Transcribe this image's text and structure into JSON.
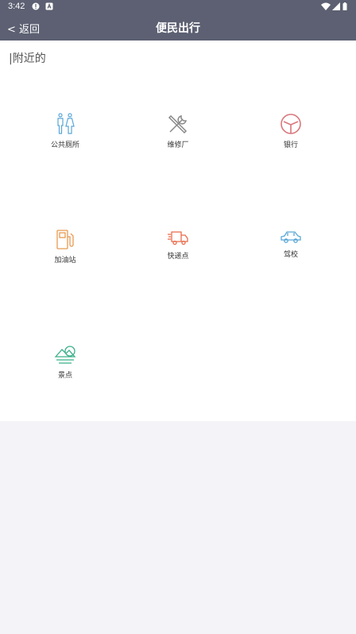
{
  "status_bar": {
    "time": "3:42"
  },
  "nav": {
    "back_label": "< 返回",
    "title": "便民出行"
  },
  "section": {
    "title": "|附近的"
  },
  "grid": [
    {
      "label": "公共厕所",
      "icon": "toilet-icon",
      "color": "#5aa7d6"
    },
    {
      "label": "维修厂",
      "icon": "tools-icon",
      "color": "#888888"
    },
    {
      "label": "银行",
      "icon": "bank-icon",
      "color": "#d9777c"
    },
    {
      "label": "加油站",
      "icon": "gas-station-icon",
      "color": "#e79a52"
    },
    {
      "label": "快递点",
      "icon": "delivery-truck-icon",
      "color": "#ea6a4b"
    },
    {
      "label": "驾校",
      "icon": "car-icon",
      "color": "#5aa7d6"
    },
    {
      "label": "景点",
      "icon": "scenery-icon",
      "color": "#3bb08a"
    }
  ]
}
